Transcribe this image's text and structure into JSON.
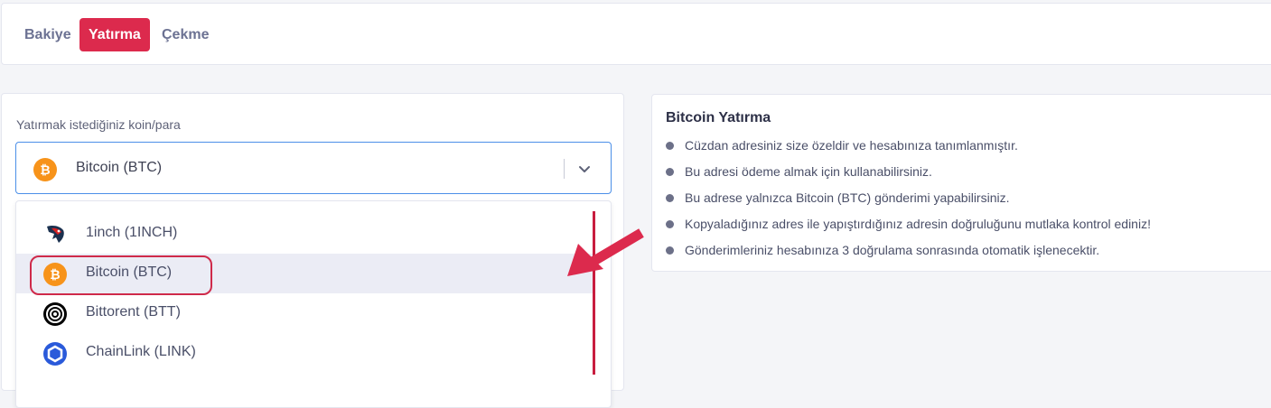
{
  "tabs": [
    {
      "label": "Bakiye"
    },
    {
      "label": "Yatırma"
    },
    {
      "label": "Çekme"
    }
  ],
  "deposit": {
    "field_label": "Yatırmak istediğiniz koin/para",
    "selected": "Bitcoin (BTC)",
    "options": [
      {
        "label": "1inch (1INCH)",
        "icon": "1inch-icon"
      },
      {
        "label": "Bitcoin (BTC)",
        "icon": "bitcoin-icon"
      },
      {
        "label": "Bittorent (BTT)",
        "icon": "bittorrent-icon"
      },
      {
        "label": "ChainLink (LINK)",
        "icon": "chainlink-icon"
      }
    ]
  },
  "info": {
    "title": "Bitcoin Yatırma",
    "items": [
      "Cüzdan adresiniz size özeldir ve hesabınıza tanımlanmıştır.",
      "Bu adresi ödeme almak için kullanabilirsiniz.",
      "Bu adrese yalnızca Bitcoin (BTC) gönderimi yapabilirsiniz.",
      "Kopyaladığınız adres ile yapıştırdığınız adresin doğruluğunu mutlaka kontrol ediniz!",
      "Gönderimleriniz hesabınıza 3 doğrulama sonrasında otomatik işlenecektir."
    ]
  },
  "colors": {
    "accent": "#dc2a4d",
    "focus_border": "#4b8fe8",
    "bitcoin": "#f7931a",
    "chainlink": "#2a5ada"
  }
}
